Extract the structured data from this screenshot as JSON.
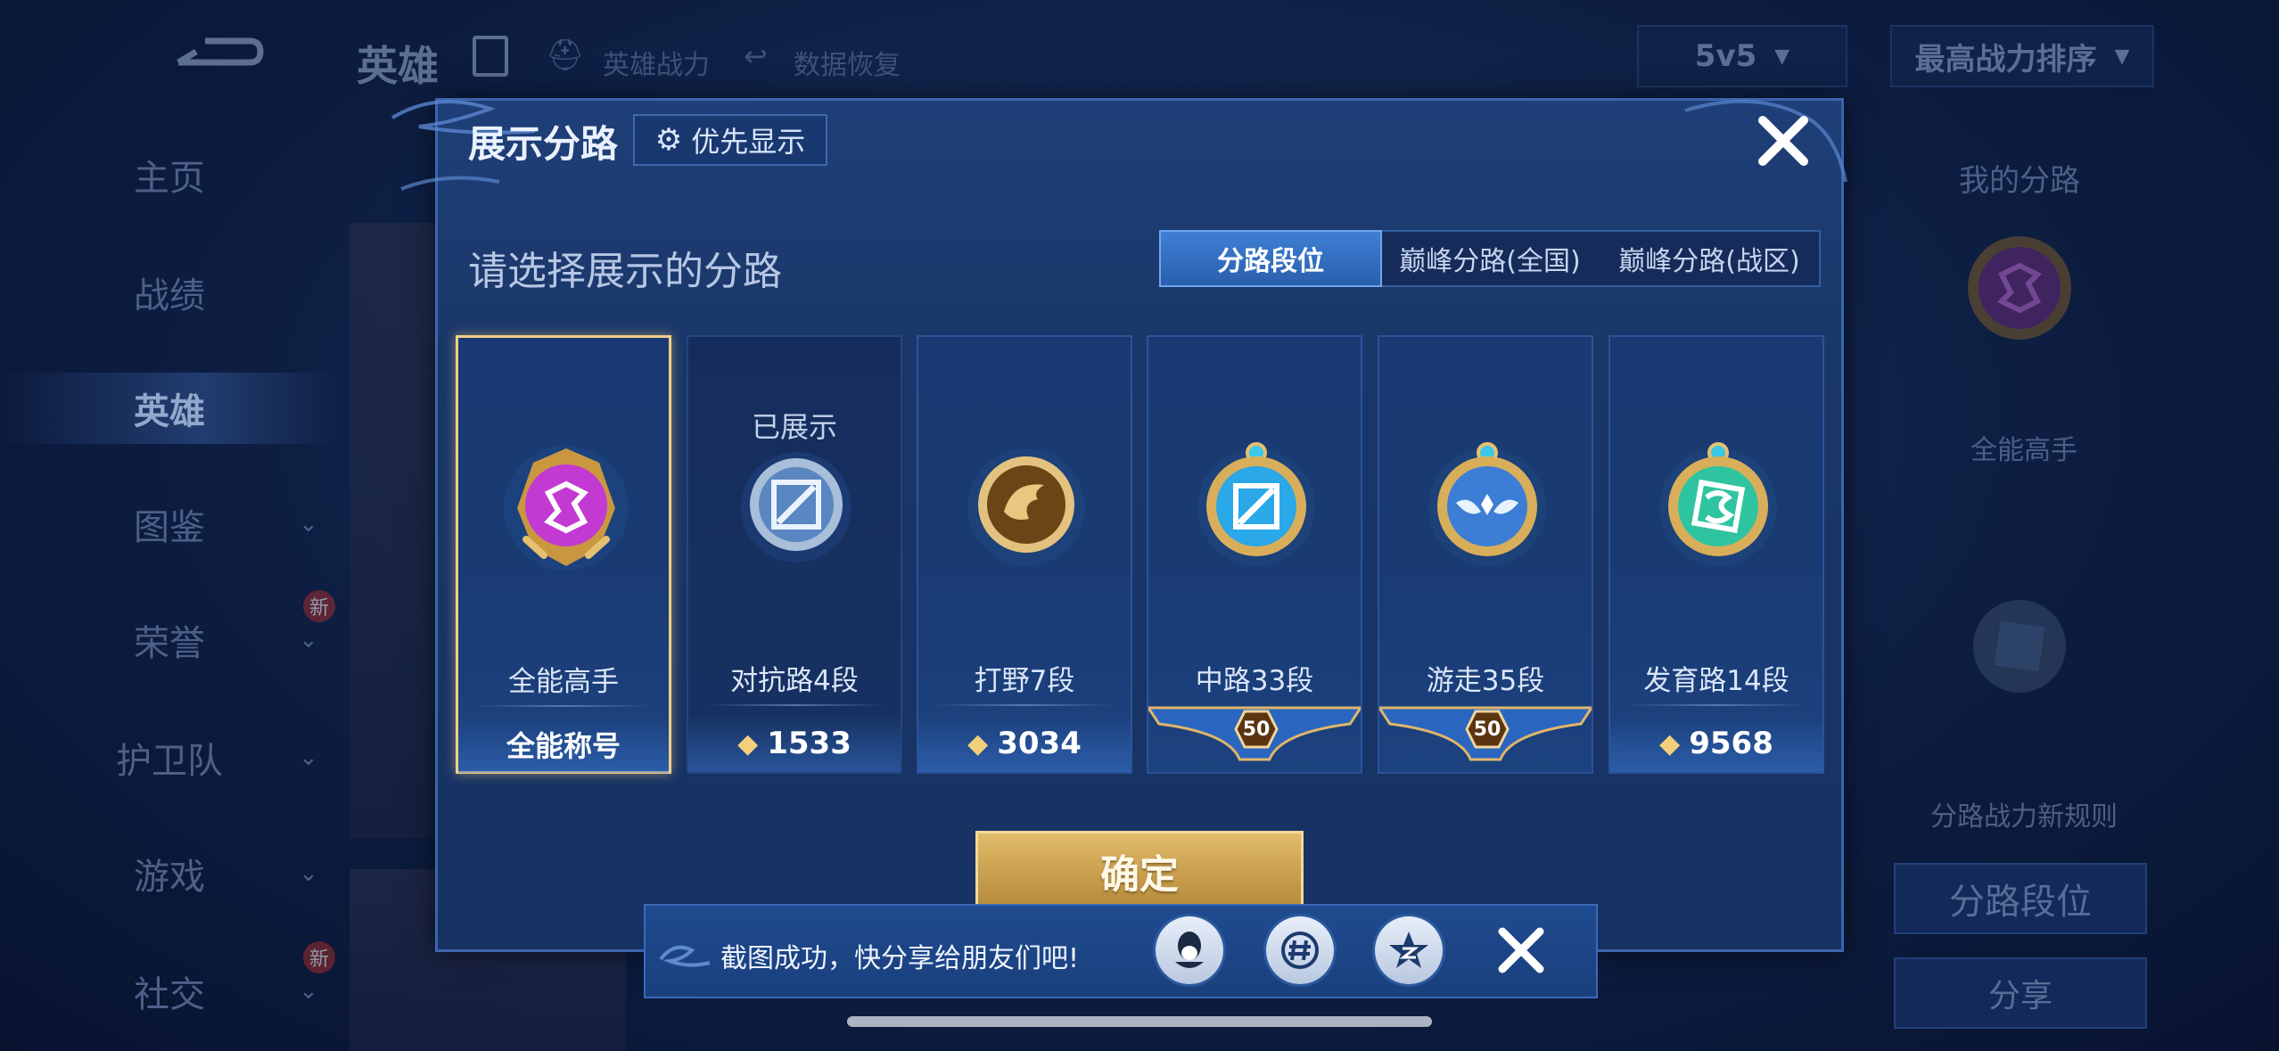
{
  "background": {
    "top_title": "英雄",
    "top_links": [
      "英雄战力",
      "数据恢复"
    ],
    "mode_select": "5v5",
    "sort_select": "最高战力排序",
    "nav": [
      {
        "label": "主页",
        "has_chevron": false
      },
      {
        "label": "战绩",
        "has_chevron": false
      },
      {
        "label": "英雄",
        "has_chevron": false,
        "active": true
      },
      {
        "label": "图鉴",
        "has_chevron": true
      },
      {
        "label": "荣誉",
        "has_chevron": true,
        "badge": "新"
      },
      {
        "label": "护卫队",
        "has_chevron": true
      },
      {
        "label": "游戏",
        "has_chevron": true
      },
      {
        "label": "社交",
        "has_chevron": true,
        "badge": "新"
      }
    ],
    "right_panel": {
      "title": "我的分路",
      "emblem_label": "全能高手",
      "rule_link": "分路战力新规则",
      "lane_rank_button": "分路段位",
      "share_button": "分享"
    }
  },
  "dialog": {
    "title": "展示分路",
    "priority_button": "优先显示",
    "subtitle": "请选择展示的分路",
    "tabs": [
      {
        "label": "分路段位",
        "active": true
      },
      {
        "label": "巅峰分路(全国)",
        "active": false
      },
      {
        "label": "巅峰分路(战区)",
        "active": false
      }
    ],
    "cards": [
      {
        "name": "全能高手",
        "footer": "全能称号",
        "footer_type": "title",
        "selected": true,
        "emblem": "all-round-emblem-icon",
        "color": "#c23ad1"
      },
      {
        "name": "对抗路4段",
        "footer": "1533",
        "footer_type": "score",
        "shown_label": "已展示",
        "emblem": "clash-lane-emblem-icon",
        "color": "#8fb0d6"
      },
      {
        "name": "打野7段",
        "footer": "3034",
        "footer_type": "score",
        "emblem": "jungle-emblem-icon",
        "color": "#c89a4a"
      },
      {
        "name": "中路33段",
        "footer": "50",
        "footer_type": "ribbon",
        "emblem": "mid-lane-emblem-icon",
        "color": "#2aa8e8"
      },
      {
        "name": "游走35段",
        "footer": "50",
        "footer_type": "ribbon",
        "emblem": "roam-emblem-icon",
        "color": "#3c7ed6"
      },
      {
        "name": "发育路14段",
        "footer": "9568",
        "footer_type": "score",
        "emblem": "farm-lane-emblem-icon",
        "color": "#2ec4a0"
      }
    ],
    "confirm_button": "确定"
  },
  "toast": {
    "text": "截图成功，快分享给朋友们吧!",
    "share_targets": [
      "qq-icon",
      "wechat-moments-icon",
      "qzone-icon"
    ]
  },
  "colors": {
    "accent_gold": "#e2bd6b",
    "tab_active": "#3f7fd4",
    "dialog_bg": "#1a3769"
  }
}
